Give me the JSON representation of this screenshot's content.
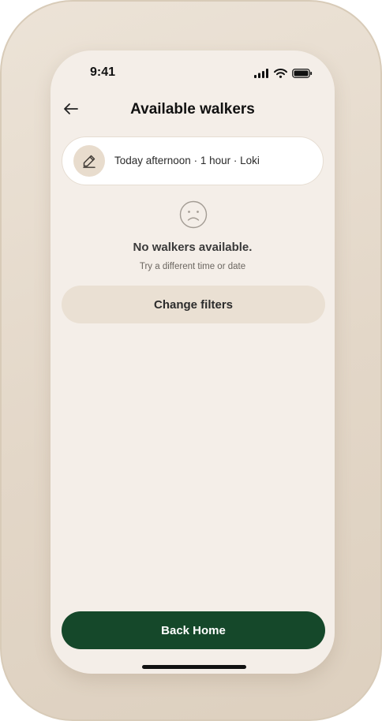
{
  "status_bar": {
    "time": "9:41",
    "icons": [
      "signal-icon",
      "wifi-icon",
      "battery-icon"
    ]
  },
  "header": {
    "title": "Available walkers",
    "back_icon": "arrow-left-icon"
  },
  "filter_card": {
    "summary": "Today afternoon · 1 hour · Loki",
    "icon": "pencil-icon"
  },
  "empty_state": {
    "icon": "sad-face-icon",
    "title": "No walkers available.",
    "subtitle": "Try a different time or date"
  },
  "actions": {
    "change_filters_label": "Change filters",
    "back_home_label": "Back Home"
  },
  "colors": {
    "screen_background": "#f4eee8",
    "secondary_button": "#eae0d3",
    "primary_button": "#15482a",
    "device_frame": "#e3d7c8"
  }
}
